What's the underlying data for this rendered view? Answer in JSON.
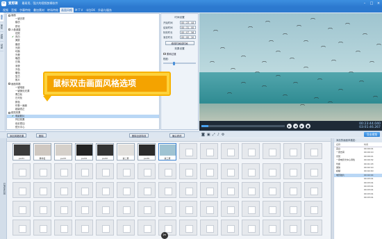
{
  "app": {
    "name": "爱剪辑",
    "title": "最易用、强大的视频剪辑软件",
    "win_buttons": [
      "–",
      "□",
      "×"
    ]
  },
  "tabs": [
    {
      "label": "视频",
      "active": false
    },
    {
      "label": "音频",
      "active": false
    },
    {
      "label": "字幕特效",
      "active": false
    },
    {
      "label": "叠加素材",
      "active": false
    },
    {
      "label": "转场特效",
      "active": false
    },
    {
      "label": "画面风格",
      "active": true
    },
    {
      "label": "M T V",
      "active": false
    },
    {
      "label": "卡拉OK",
      "active": false
    },
    {
      "label": "升级与服务",
      "active": false
    }
  ],
  "side_tabs": [
    "画面",
    "美化",
    "滤镜",
    "动景"
  ],
  "tree": [
    {
      "label": "画面",
      "type": "grp"
    },
    {
      "label": "一键去雾",
      "type": "item"
    },
    {
      "label": "模仿",
      "type": "item"
    },
    {
      "label": "锐化",
      "type": "item"
    },
    {
      "label": "人像调整",
      "type": "grp"
    },
    {
      "label": "祛斑",
      "type": "item"
    },
    {
      "label": "亮白",
      "type": "item",
      "checked": true
    },
    {
      "label": "美肤",
      "type": "item"
    },
    {
      "label": "磨皮",
      "type": "item"
    },
    {
      "label": "光斑",
      "type": "item"
    },
    {
      "label": "均衡",
      "type": "item"
    },
    {
      "label": "光晕",
      "type": "item"
    },
    {
      "label": "晚霞",
      "type": "item"
    },
    {
      "label": "日落",
      "type": "item"
    },
    {
      "label": "深夜",
      "type": "item"
    },
    {
      "label": "冷色",
      "type": "item"
    },
    {
      "label": "暖色",
      "type": "item"
    },
    {
      "label": "复古",
      "type": "item"
    },
    {
      "label": "胶片",
      "type": "item"
    },
    {
      "label": "画面风格",
      "type": "grp"
    },
    {
      "label": "一键电影",
      "type": "item"
    },
    {
      "label": "一键美化光源",
      "type": "item"
    },
    {
      "label": "黑白化",
      "type": "item"
    },
    {
      "label": "日光化",
      "type": "item"
    },
    {
      "label": "颜色",
      "type": "item"
    },
    {
      "label": "印象一画面",
      "type": "item"
    },
    {
      "label": "超级改正",
      "type": "item"
    },
    {
      "label": "超炫效果",
      "type": "grp"
    },
    {
      "label": "电影胶片",
      "type": "item",
      "selected": true,
      "checked": true
    },
    {
      "label": "怀旧效果",
      "type": "item"
    },
    {
      "label": "色彩叠加",
      "type": "item"
    },
    {
      "label": "镜头中心",
      "type": "item"
    },
    {
      "label": "模糊",
      "type": "item"
    }
  ],
  "settings": {
    "title": "时间设置",
    "rows": [
      {
        "label": "开始时间",
        "value": "00 : 23 . 44"
      },
      {
        "label": "结束时间",
        "value": "00 : 31 . 00"
      },
      {
        "label": "特效时长",
        "value": "00 : 07 . 56"
      },
      {
        "label": "渐变时长",
        "value": "00 : 00 . 20"
      }
    ],
    "apply_button": "修改时间线时间",
    "param_title": "效果设置",
    "check_label": "柔和过渡",
    "degree_label": "程度："
  },
  "preview": {
    "time_current": "00:23:44.040",
    "time_total": "03:01:46.267",
    "progress_fraction": 0.08
  },
  "preview_tools": {
    "export_label": "导出视频"
  },
  "buttons": {
    "add_effect": "添加风格效果",
    "delete": "删除",
    "delete_all": "删除全部特效",
    "confirm": "确认修改"
  },
  "track_header": "已添加片段",
  "clips": [
    {
      "label": "part1",
      "color": "#3a3a3a"
    },
    {
      "label": "重命名",
      "color": "#cfc8c1"
    },
    {
      "label": "part3",
      "color": "#d5d0ca"
    },
    {
      "label": "part4",
      "color": "#222"
    },
    {
      "label": "part2",
      "color": "#333"
    },
    {
      "label": "第二幕",
      "color": "#e2e0dd"
    },
    {
      "label": "part9",
      "color": "#2b2b2b"
    },
    {
      "label": "第三幕",
      "color": "#9fc3d2",
      "selected": true
    }
  ],
  "callout": {
    "text": "鼠标双击画面风格选项"
  },
  "music_panel": {
    "title": "添加的画面风格如：",
    "col_name": "名称",
    "col_time": "时间",
    "rows": [
      {
        "name": "亮白",
        "time": "00:00:01"
      },
      {
        "name": "一键去雾",
        "time": "00:00:10"
      },
      {
        "name": "光斑",
        "time": "00:00:21"
      },
      {
        "name": "一键电影光中心调色",
        "time": "00:00:32"
      },
      {
        "name": "均衡",
        "time": "00:01:03"
      },
      {
        "name": "美肤",
        "time": "00:02:10"
      },
      {
        "name": "模糊",
        "time": "00:02:40"
      },
      {
        "name": "电影胶片",
        "time": "00:02:44",
        "selected": true
      },
      {
        "name": "",
        "time": "00:03:01"
      },
      {
        "name": "",
        "time": "00:03:01"
      },
      {
        "name": "",
        "time": "00:03:01"
      },
      {
        "name": "",
        "time": "00:03:01"
      },
      {
        "name": "",
        "time": "00:03:01"
      },
      {
        "name": "",
        "time": "00:03:01"
      }
    ]
  },
  "colors": {
    "brand": "#2c79cf",
    "accent": "#f4a300",
    "highlight": "#b9d7f5"
  }
}
